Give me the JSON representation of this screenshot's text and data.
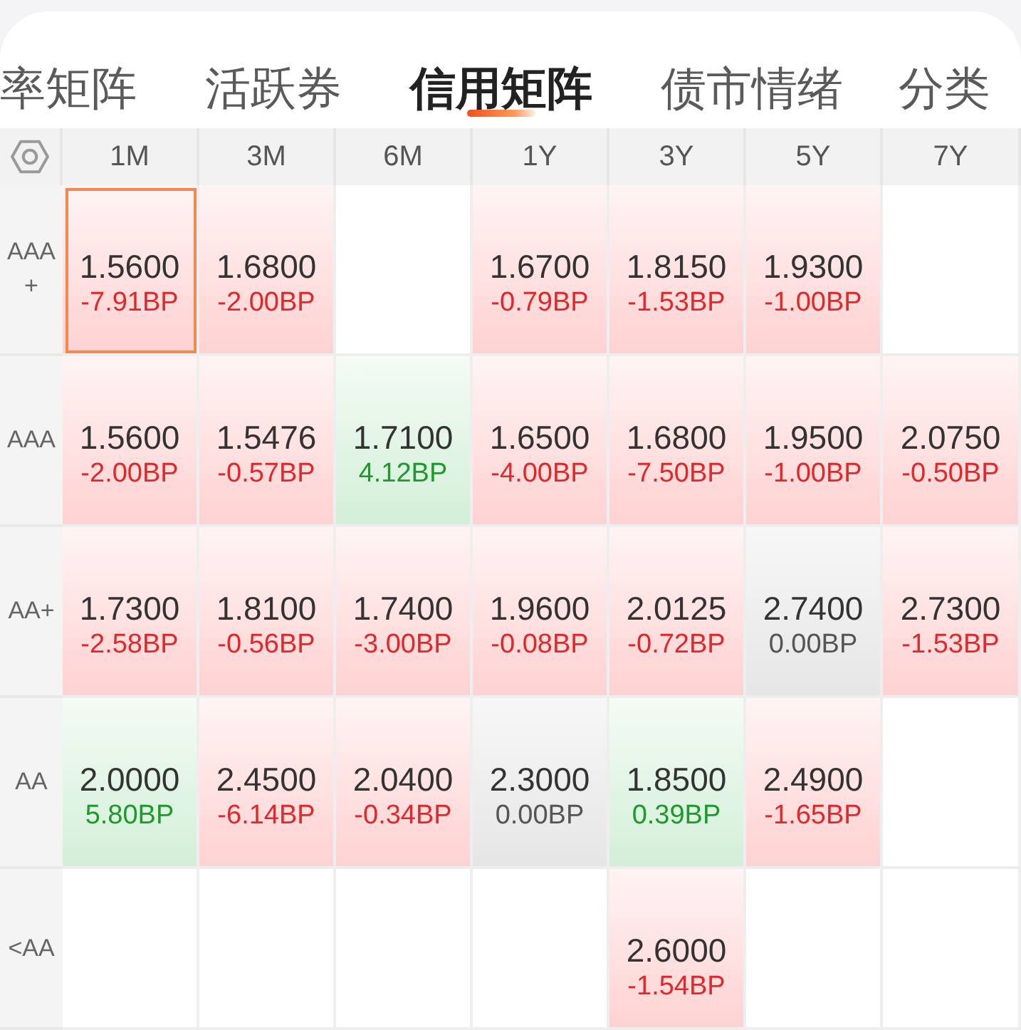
{
  "tabs": [
    {
      "label": "率矩阵",
      "selected": false
    },
    {
      "label": "活跃券",
      "selected": false
    },
    {
      "label": "信用矩阵",
      "selected": true
    },
    {
      "label": "债市情绪",
      "selected": false
    }
  ],
  "category_button": {
    "label": "分类"
  },
  "matrix": {
    "columns": [
      "1M",
      "3M",
      "6M",
      "1Y",
      "3Y",
      "5Y",
      "7Y"
    ],
    "rows": [
      {
        "label": "AAA+",
        "cells": [
          {
            "kind": "down",
            "value": "1.5600",
            "change": "-7.91BP",
            "selected": true
          },
          {
            "kind": "down",
            "value": "1.6800",
            "change": "-2.00BP",
            "selected": false
          },
          {
            "kind": "empty",
            "selected": false
          },
          {
            "kind": "down",
            "value": "1.6700",
            "change": "-0.79BP",
            "selected": false
          },
          {
            "kind": "down",
            "value": "1.8150",
            "change": "-1.53BP",
            "selected": false
          },
          {
            "kind": "down",
            "value": "1.9300",
            "change": "-1.00BP",
            "selected": false
          },
          {
            "kind": "empty",
            "selected": false
          }
        ]
      },
      {
        "label": "AAA",
        "cells": [
          {
            "kind": "down",
            "value": "1.5600",
            "change": "-2.00BP",
            "selected": false
          },
          {
            "kind": "down",
            "value": "1.5476",
            "change": "-0.57BP",
            "selected": false
          },
          {
            "kind": "up",
            "value": "1.7100",
            "change": "4.12BP",
            "selected": false
          },
          {
            "kind": "down",
            "value": "1.6500",
            "change": "-4.00BP",
            "selected": false
          },
          {
            "kind": "down",
            "value": "1.6800",
            "change": "-7.50BP",
            "selected": false
          },
          {
            "kind": "down",
            "value": "1.9500",
            "change": "-1.00BP",
            "selected": false
          },
          {
            "kind": "down",
            "value": "2.0750",
            "change": "-0.50BP",
            "selected": false
          }
        ]
      },
      {
        "label": "AA+",
        "cells": [
          {
            "kind": "down",
            "value": "1.7300",
            "change": "-2.58BP",
            "selected": false
          },
          {
            "kind": "down",
            "value": "1.8100",
            "change": "-0.56BP",
            "selected": false
          },
          {
            "kind": "down",
            "value": "1.7400",
            "change": "-3.00BP",
            "selected": false
          },
          {
            "kind": "down",
            "value": "1.9600",
            "change": "-0.08BP",
            "selected": false
          },
          {
            "kind": "down",
            "value": "2.0125",
            "change": "-0.72BP",
            "selected": false
          },
          {
            "kind": "flat",
            "value": "2.7400",
            "change": "0.00BP",
            "selected": false
          },
          {
            "kind": "down",
            "value": "2.7300",
            "change": "-1.53BP",
            "selected": false
          }
        ]
      },
      {
        "label": "AA",
        "cells": [
          {
            "kind": "up",
            "value": "2.0000",
            "change": "5.80BP",
            "selected": false
          },
          {
            "kind": "down",
            "value": "2.4500",
            "change": "-6.14BP",
            "selected": false
          },
          {
            "kind": "down",
            "value": "2.0400",
            "change": "-0.34BP",
            "selected": false
          },
          {
            "kind": "flat",
            "value": "2.3000",
            "change": "0.00BP",
            "selected": false
          },
          {
            "kind": "up",
            "value": "1.8500",
            "change": "0.39BP",
            "selected": false
          },
          {
            "kind": "down",
            "value": "2.4900",
            "change": "-1.65BP",
            "selected": false
          },
          {
            "kind": "empty",
            "selected": false
          }
        ]
      },
      {
        "label": "<AA",
        "cells": [
          {
            "kind": "empty",
            "selected": false
          },
          {
            "kind": "empty",
            "selected": false
          },
          {
            "kind": "empty",
            "selected": false
          },
          {
            "kind": "empty",
            "selected": false
          },
          {
            "kind": "down",
            "value": "2.6000",
            "change": "-1.54BP",
            "selected": false
          },
          {
            "kind": "empty",
            "selected": false
          },
          {
            "kind": "empty",
            "selected": false
          }
        ]
      }
    ]
  }
}
